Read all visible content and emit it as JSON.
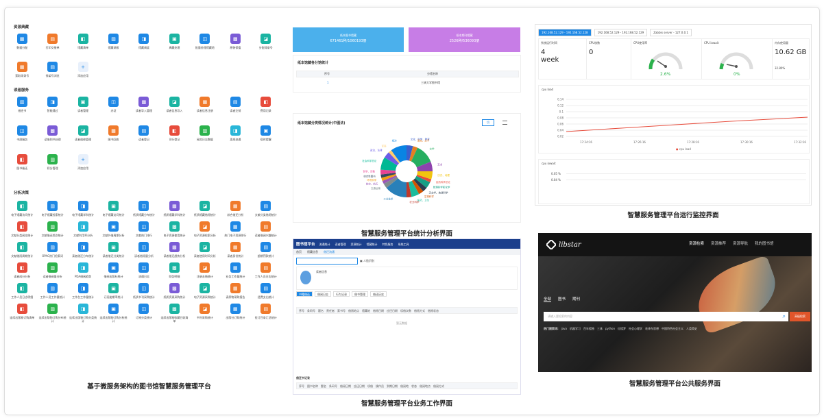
{
  "left": {
    "section1": "资源典藏",
    "row1": [
      "数据分配",
      "打印交接单",
      "馆藏清单",
      "馆藏调拨",
      "馆藏调度",
      "典藏处理",
      "批量处理馆藏地",
      "原装保值",
      "分配滞录号"
    ],
    "row2": [
      "索取滞录号",
      "排架号浏览",
      "添加应用"
    ],
    "section2": "读者服务",
    "row3": [
      "借还书",
      "智能通过",
      "读者管理",
      "办证",
      "读者导入管理",
      "读者信息导入",
      "读者信息注册",
      "读者注销",
      "费用记录"
    ],
    "row4": [
      "书屏服务",
      "读借到书处理",
      "读者维修管理",
      "图书回收",
      "读者登记",
      "司行登记",
      "阅览日志数据",
      "离线流通",
      "宿时提醒"
    ],
    "row5": [
      "图书催还",
      "积分管理",
      "添加应用"
    ],
    "section3": "分析决策",
    "grid": [
      "电子馆藏访问统计",
      "电子馆藏检索统计",
      "电子馆藏学科统计",
      "电子馆藏访问统计",
      "纸质馆藏分布统计",
      "纸质馆藏学科统计",
      "纸质馆藏借阅统计",
      "综合借还分析",
      "文献分类借阅统计",
      "文献分类阅览统计",
      "文献借还频次统计",
      "文献利用率分析",
      "文献外借周期分析",
      "文献热门排行",
      "电子资源使用统计",
      "电子资源检索分析",
      "热门电子资源排行",
      "读者借阅兴趣统计",
      "文献借阅周期统计",
      "OPAC热门检索词",
      "读者借还分布统计",
      "读者借还分类统计",
      "读者借阅量分析",
      "读者借还趋势分析",
      "读者使用时间分析",
      "读者身份统计",
      "超期罚款统计",
      "读者成分分析",
      "读者借阅量分析",
      "PDA借阅趋势",
      "借阅出版社统计",
      "流通日志",
      "财务明细",
      "注册去借统计",
      "业务工作量统计",
      "工作人员日志统计",
      "工作人员日志明细",
      "工作人员工作量统计",
      "工作台工作量统计",
      "订阅逾期率统计",
      "纸质书刊采购统计",
      "纸质资源采购统计",
      "电子资源采购统计",
      "读原物采购报告",
      "经费支出统计",
      "连续出版物订购清单",
      "连续出版物订购分布统计",
      "连续出版物订购分类统计",
      "连续出版物订购分析统计",
      "订阅分类统计",
      "连续出版物收藏已收清单",
      "书刊采购统计",
      "出版社订购统计",
      "征订目录汇总统计"
    ],
    "caption": "基于微服务架构的图书馆智慧服务管理平台"
  },
  "stats": {
    "card1_title": "纸本图书馆藏",
    "card1_value": "671461种/1060193册",
    "card2_title": "纸本期刊馆藏",
    "card2_value": "2526种/536093册",
    "table_title": "纸本馆藏各分馆统计",
    "col1": "序号",
    "col2": "分馆名称",
    "row_no": "1",
    "row_name": "三峡大学图书馆",
    "pie_title": "纸本馆藏分类情况统计(中图法)",
    "btn": "切",
    "labels": [
      "文化、科学、教育",
      "语言、文字",
      "文学",
      "艺术",
      "历史、地理",
      "自然科学总论",
      "数理科学和化学",
      "天文学、地球科学",
      "生物科学",
      "医药、卫生",
      "农业科学",
      "工业技术",
      "交通运输",
      "航空、航天",
      "环境科学",
      "综合性图书",
      "哲学、宗教",
      "社会科学总论",
      "政治、法律",
      "军事",
      "经济"
    ],
    "caption": "智慧服务管理平台统计分析界面"
  },
  "monitor": {
    "tabs": [
      "192.168.52.129 - 192.168.52.128",
      "192.168.52.129 - 192.168.52.129",
      "Zabbix server - 127.0.0.1"
    ],
    "m1_label": "系统运行时间",
    "m1_value": "4",
    "m1_unit": "week",
    "m2_label": "CPU核数",
    "m2_value": "0",
    "m3_label": "CPU使用率",
    "m3_pct": "2.6%",
    "m4_label": "CPU iowait",
    "m4_pct": "0%",
    "m5_label": "内存使用量",
    "m5_value": "10.62 GB",
    "m5_sub": "32.80%",
    "chart1": "cpu load",
    "legend": "cpu load",
    "chart2": "cpu iowait",
    "yticks": [
      "0.14",
      "0.12",
      "0.1",
      "0.08",
      "0.06",
      "0.04",
      "0.02"
    ],
    "xticks": [
      "17:24:16",
      "17:26:16",
      "17:28:16",
      "17:30:16",
      "17:32:16"
    ],
    "iow": [
      "0.05 %",
      "0.04 %"
    ],
    "caption": "智慧服务管理平台运行监控界面"
  },
  "work": {
    "brand": "图书馆平台",
    "nav": [
      "流通统计",
      "读者管理",
      "资源统计",
      "馆藏统计",
      "特色服务",
      "系统工具"
    ],
    "tabs": [
      "首页",
      "馆藏信息",
      "借还流通"
    ],
    "btn": "人脸识别",
    "reader_label": "读者信息",
    "subtabs": [
      "书籍借还",
      "借阅日志",
      "行为记录",
      "借书管理",
      "借还历史"
    ],
    "cols": [
      "序号",
      "条码号",
      "题名",
      "责任者",
      "索书号",
      "借阅地点",
      "馆藏地",
      "借阅日期",
      "应还日期",
      "续借次数",
      "借阅方式",
      "借阅状态"
    ],
    "empty": "暂无数据",
    "cols2": [
      "序号",
      "图书名称",
      "题名",
      "条码号",
      "借阅日期",
      "应还日期",
      "续借",
      "操作员",
      "到期日期",
      "借阅地",
      "状态",
      "借阅地点",
      "借阅方式"
    ],
    "sec2": "借还书记录",
    "caption": "智慧服务管理平台业务工作界面"
  },
  "pub": {
    "logo": "libstar",
    "nav": [
      "资源检索",
      "资源推荐",
      "资源导航",
      "我的图书馆"
    ],
    "tabs": [
      "全部",
      "图书",
      "期刊"
    ],
    "placeholder": "请输入要检索的内容",
    "search_btn": "高级检索",
    "hot_label": "热门搜索词:",
    "hot": [
      "java",
      "机器学习",
      "百年孤独",
      "三体",
      "python",
      "红楼梦",
      "社会心理学",
      "毛泽东思想",
      "中国特色社会主义",
      "人类简史"
    ],
    "caption": "智慧服务管理平台公共服务界面"
  }
}
